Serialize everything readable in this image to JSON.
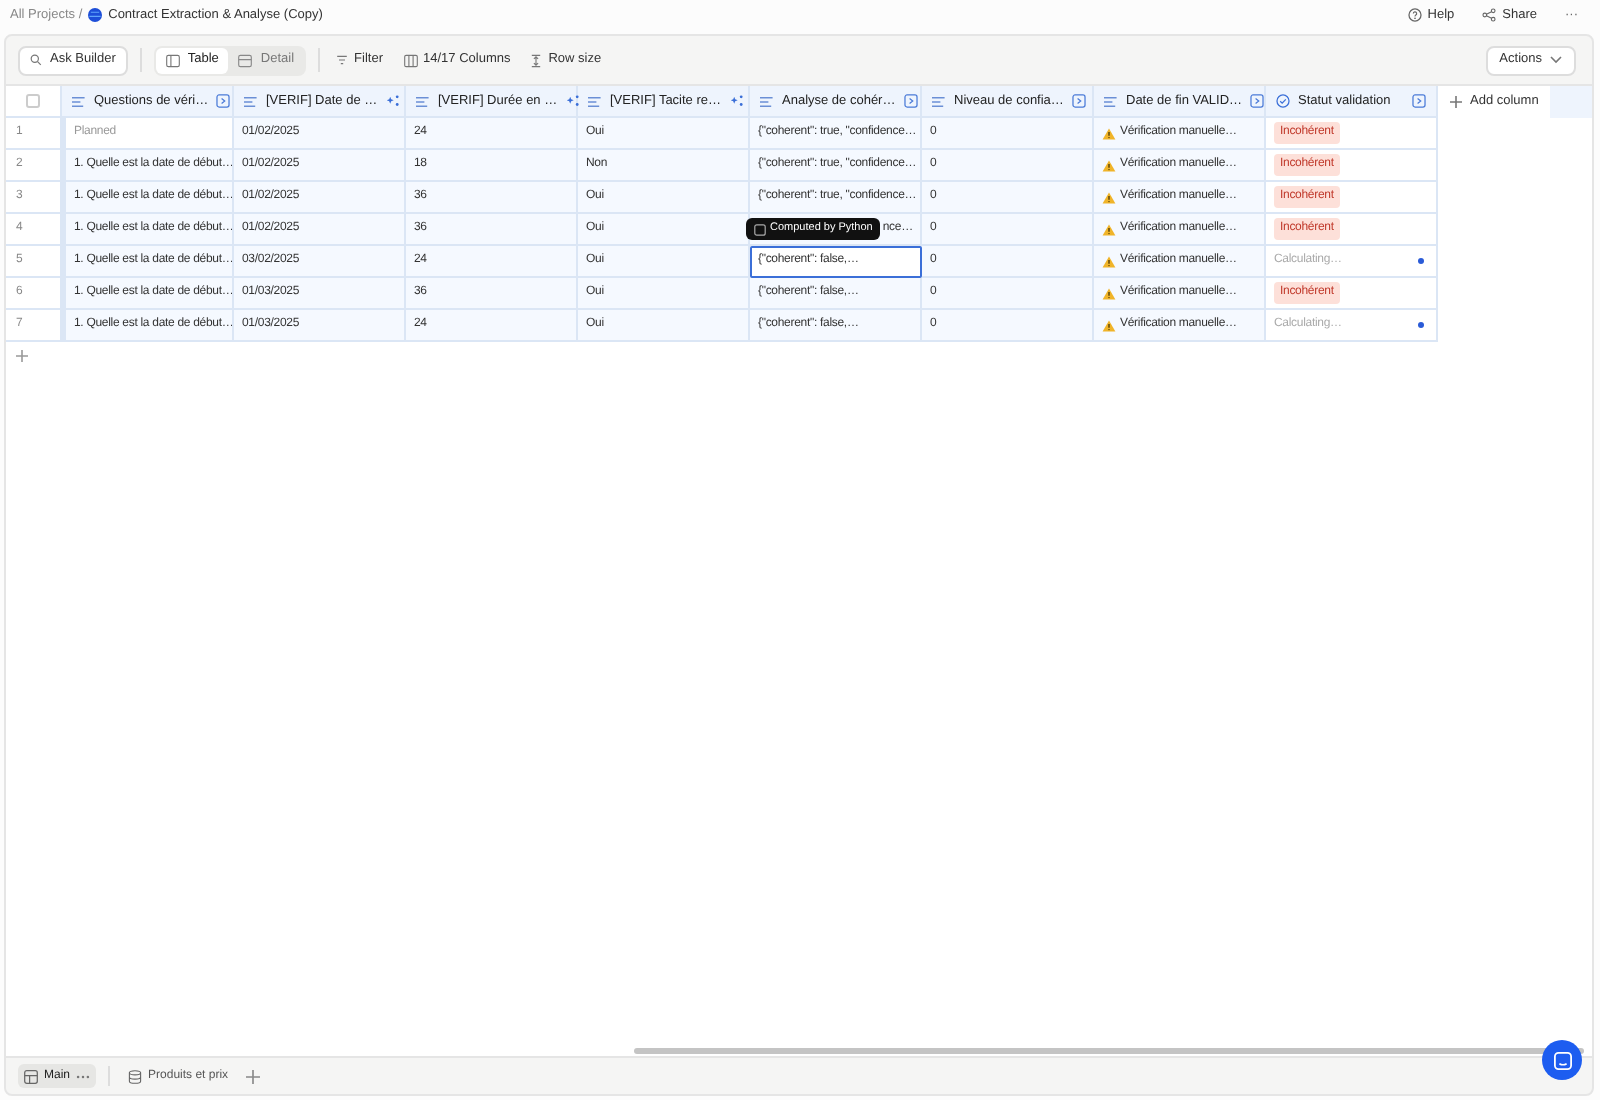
{
  "breadcrumb": {
    "root": "All Projects /",
    "project": "Contract Extraction & Analyse (Copy)"
  },
  "top_actions": [
    {
      "kind": "help",
      "label": "Help"
    },
    {
      "kind": "share",
      "label": "Share"
    },
    {
      "kind": "more",
      "label": "···"
    }
  ],
  "toolbar": {
    "ask": "Ask Builder",
    "views": [
      {
        "label": "Table",
        "selected": true
      },
      {
        "label": "Detail",
        "selected": false
      }
    ],
    "filter": "Filter",
    "columns": "14/17 Columns",
    "row_size": "Row size",
    "actions": "Actions"
  },
  "columns": [
    {
      "label": "Questions de véri…",
      "kind": "text_run"
    },
    {
      "label": "[VERIF] Date de …",
      "kind": "text_ai"
    },
    {
      "label": "[VERIF] Durée en …",
      "kind": "text_ai"
    },
    {
      "label": "[VERIF] Tacite re…",
      "kind": "text_ai"
    },
    {
      "label": "Analyse de cohér…",
      "kind": "text_run"
    },
    {
      "label": "Niveau de confia…",
      "kind": "text_run"
    },
    {
      "label": "Date de fin VALID…",
      "kind": "text_run"
    },
    {
      "label": "Statut validation",
      "kind": "status_run"
    }
  ],
  "select_all": {
    "checked": false
  },
  "add_column": "Add column",
  "rows": [
    {
      "num": "1",
      "question": "Planned",
      "question_muted": true,
      "date": "01/02/2025",
      "duree": "24",
      "tacite": "Oui",
      "analyse": "{\"coherent\": true, \"confidence…",
      "analyse_selected": false,
      "niveau": "0",
      "date_fin": "Vérification manuelle…",
      "statut": {
        "kind": "badge",
        "text": "Incohérent"
      }
    },
    {
      "num": "2",
      "question": "1. Quelle est la date de début…",
      "question_muted": false,
      "date": "01/02/2025",
      "duree": "18",
      "tacite": "Non",
      "analyse": "{\"coherent\": true, \"confidence…",
      "analyse_selected": false,
      "niveau": "0",
      "date_fin": "Vérification manuelle…",
      "statut": {
        "kind": "badge",
        "text": "Incohérent"
      }
    },
    {
      "num": "3",
      "question": "1. Quelle est la date de début…",
      "question_muted": false,
      "date": "01/02/2025",
      "duree": "36",
      "tacite": "Oui",
      "analyse": "{\"coherent\": true, \"confidence…",
      "analyse_selected": false,
      "niveau": "0",
      "date_fin": "Vérification manuelle…",
      "statut": {
        "kind": "badge",
        "text": "Incohérent"
      }
    },
    {
      "num": "4",
      "question": "1. Quelle est la date de début…",
      "question_muted": false,
      "date": "01/02/2025",
      "duree": "36",
      "tacite": "Oui",
      "analyse": "nce…",
      "tooltip": "Computed by Python",
      "analyse_selected": false,
      "niveau": "0",
      "date_fin": "Vérification manuelle…",
      "statut": {
        "kind": "badge",
        "text": "Incohérent"
      }
    },
    {
      "num": "5",
      "question": "1. Quelle est la date de début…",
      "question_muted": false,
      "date": "03/02/2025",
      "duree": "24",
      "tacite": "Oui",
      "analyse": "{\"coherent\": false,…",
      "analyse_selected": true,
      "niveau": "0",
      "date_fin": "Vérification manuelle…",
      "statut": {
        "kind": "pending",
        "text": "Calculating…"
      }
    },
    {
      "num": "6",
      "question": "1. Quelle est la date de début…",
      "question_muted": false,
      "date": "01/03/2025",
      "duree": "36",
      "tacite": "Oui",
      "analyse": "{\"coherent\": false,…",
      "analyse_selected": false,
      "niveau": "0",
      "date_fin": "Vérification manuelle…",
      "statut": {
        "kind": "badge",
        "text": "Incohérent"
      }
    },
    {
      "num": "7",
      "question": "1. Quelle est la date de début…",
      "question_muted": false,
      "date": "01/03/2025",
      "duree": "24",
      "tacite": "Oui",
      "analyse": "{\"coherent\": false,…",
      "analyse_selected": false,
      "niveau": "0",
      "date_fin": "Vérification manuelle…",
      "statut": {
        "kind": "pending",
        "text": "Calculating…"
      }
    }
  ],
  "sheets": [
    {
      "label": "Main",
      "selected": true
    },
    {
      "label": "Produits et prix",
      "selected": false
    }
  ]
}
